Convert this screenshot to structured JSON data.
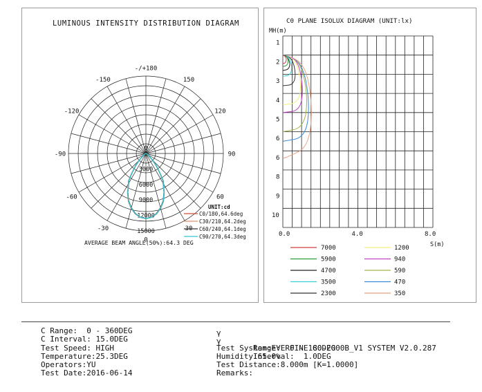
{
  "left_chart": {
    "title": "LUMINOUS INTENSITY DISTRIBUTION DIAGRAM",
    "angle_labels": [
      "-/+180",
      "-150",
      "150",
      "-120",
      "120",
      "-90",
      "90",
      "-60",
      "60",
      "-30",
      "30",
      "0"
    ],
    "radial_labels": [
      "0",
      "3000",
      "6000",
      "9000",
      "12000",
      "15000"
    ],
    "unit_label": "UNIT:cd",
    "legend": [
      {
        "text": "C0/180,64.6deg",
        "color": "#d04a3a"
      },
      {
        "text": "C30/210,64.2deg",
        "color": "#e08f6a"
      },
      {
        "text": "C60/240,64.1deg",
        "color": "#333333"
      },
      {
        "text": "C90/270,64.3deg",
        "color": "#34c6d2"
      }
    ],
    "beam_angle_text": "AVERAGE BEAM ANGLE(50%):64.3 DEG"
  },
  "right_chart": {
    "title": "C0 PLANE ISOLUX DIAGRAM (UNIT:lx)",
    "y_axis_label": "MH(m)",
    "x_axis_label": "S(m)",
    "y_ticks": [
      "1",
      "2",
      "3",
      "4",
      "5",
      "6",
      "6",
      "8",
      "9",
      "10"
    ],
    "x_ticks": [
      "0.0",
      "4.0",
      "8.0"
    ],
    "legend": [
      {
        "value": "7000",
        "color": "#d23c3c"
      },
      {
        "value": "1200",
        "color": "#f2f07a"
      },
      {
        "value": "5900",
        "color": "#2d9a3a"
      },
      {
        "value": "940",
        "color": "#c040c8"
      },
      {
        "value": "4700",
        "color": "#222222"
      },
      {
        "value": "590",
        "color": "#a4b44a"
      },
      {
        "value": "3500",
        "color": "#38d0d8"
      },
      {
        "value": "470",
        "color": "#3a8ad8"
      },
      {
        "value": "2300",
        "color": "#333333"
      },
      {
        "value": "350",
        "color": "#e8a080"
      }
    ]
  },
  "chart_data": [
    {
      "type": "polar-line",
      "title": "LUMINOUS INTENSITY DISTRIBUTION DIAGRAM",
      "unit": "cd",
      "angle_ticks": [
        "-/+180",
        "-150",
        "150",
        "-120",
        "120",
        "-90",
        "90",
        "-60",
        "60",
        "-30",
        "30",
        "0"
      ],
      "radial_ticks": [
        0,
        3000,
        6000,
        9000,
        12000,
        15000
      ],
      "rmax": 15000,
      "series": [
        {
          "name": "C0/180,64.6deg",
          "color": "#d04a3a",
          "angles": [
            0,
            5,
            10,
            15,
            20,
            25,
            30,
            32.3,
            35,
            40,
            45,
            50,
            55,
            60,
            70,
            80,
            90
          ],
          "values": [
            12600,
            12400,
            11900,
            11000,
            9900,
            8400,
            6700,
            6300,
            5000,
            3200,
            1800,
            1000,
            600,
            380,
            150,
            40,
            0
          ]
        },
        {
          "name": "C30/210,64.2deg",
          "color": "#e08f6a",
          "angles": [
            0,
            5,
            10,
            15,
            20,
            25,
            30,
            32.1,
            35,
            40,
            45,
            50,
            55,
            60,
            70,
            80,
            90
          ],
          "values": [
            12600,
            12400,
            11800,
            10900,
            9800,
            8300,
            6700,
            6300,
            4900,
            3100,
            1800,
            1000,
            600,
            370,
            140,
            40,
            0
          ]
        },
        {
          "name": "C60/240,64.1deg",
          "color": "#333333",
          "angles": [
            0,
            5,
            10,
            15,
            20,
            25,
            30,
            32.05,
            35,
            40,
            45,
            50,
            55,
            60,
            70,
            80,
            90
          ],
          "values": [
            12600,
            12400,
            11800,
            10900,
            9800,
            8300,
            6700,
            6300,
            4900,
            3100,
            1800,
            1000,
            600,
            370,
            140,
            40,
            0
          ]
        },
        {
          "name": "C90/270,64.3deg",
          "color": "#34c6d2",
          "angles": [
            0,
            5,
            10,
            15,
            20,
            25,
            30,
            32.15,
            35,
            40,
            45,
            50,
            55,
            60,
            70,
            80,
            90
          ],
          "values": [
            12600,
            12400,
            11850,
            10950,
            9850,
            8350,
            6700,
            6300,
            4950,
            3150,
            1800,
            1000,
            600,
            375,
            145,
            40,
            0
          ]
        }
      ],
      "annotation": "AVERAGE BEAM ANGLE(50%):64.3 DEG"
    },
    {
      "type": "contour",
      "title": "C0 PLANE ISOLUX DIAGRAM (UNIT:lx)",
      "xlabel": "S(m)",
      "ylabel": "MH(m)",
      "xlim": [
        0,
        8
      ],
      "ylim": [
        10,
        0
      ],
      "series": [
        {
          "name": "7000",
          "color": "#d23c3c",
          "x": [
            0,
            0.12,
            0.2,
            0.15,
            0
          ],
          "y": [
            1,
            1.05,
            1.2,
            1.4,
            1.45
          ]
        },
        {
          "name": "5900",
          "color": "#2d9a3a",
          "x": [
            0,
            0.2,
            0.3,
            0.22,
            0
          ],
          "y": [
            1,
            1.05,
            1.3,
            1.55,
            1.6
          ]
        },
        {
          "name": "4700",
          "color": "#222222",
          "x": [
            0,
            0.25,
            0.4,
            0.3,
            0
          ],
          "y": [
            1,
            1.1,
            1.45,
            1.75,
            1.8
          ]
        },
        {
          "name": "3500",
          "color": "#38d0d8",
          "x": [
            0,
            0.35,
            0.5,
            0.4,
            0
          ],
          "y": [
            1,
            1.1,
            1.6,
            2.05,
            2.1
          ]
        },
        {
          "name": "2300",
          "color": "#333333",
          "x": [
            0,
            0.5,
            0.7,
            0.55,
            0
          ],
          "y": [
            1,
            1.15,
            2,
            2.55,
            2.6
          ]
        },
        {
          "name": "1200",
          "color": "#f2f07a",
          "x": [
            0,
            0.7,
            1,
            0.8,
            0
          ],
          "y": [
            1,
            1.2,
            2.6,
            3.5,
            3.6
          ]
        },
        {
          "name": "940",
          "color": "#c040c8",
          "x": [
            0,
            0.8,
            1.1,
            0.9,
            0
          ],
          "y": [
            1,
            1.2,
            2.8,
            3.9,
            4
          ]
        },
        {
          "name": "590",
          "color": "#a4b44a",
          "x": [
            0,
            0.95,
            1.35,
            1.1,
            0
          ],
          "y": [
            1,
            1.3,
            3.3,
            4.8,
            5
          ]
        },
        {
          "name": "470",
          "color": "#3a8ad8",
          "x": [
            0,
            1.05,
            1.45,
            1.2,
            0
          ],
          "y": [
            1,
            1.35,
            3.6,
            5.3,
            5.5
          ]
        },
        {
          "name": "350",
          "color": "#e8a080",
          "x": [
            0,
            1.2,
            1.6,
            1.35,
            0.3,
            0
          ],
          "y": [
            1,
            1.4,
            3.8,
            5.8,
            6.3,
            6.4
          ]
        }
      ]
    }
  ],
  "info": {
    "left": [
      "C Range:  0 - 360DEG",
      "C Interval: 15.0DEG",
      "Test Speed: HIGH",
      "Temperature:25.3DEG",
      "Operators:YU",
      "Test Date:2016-06-14"
    ],
    "right": [
      "  Range:  0 - 180DEG",
      "  Interval:  1.0DEG",
      "Test System:EVERFINE GO-2000B_V1 SYSTEM V2.0.287",
      "Humidity:65.0%",
      "Test Distance:8.000m [K=1.0000]",
      "Remarks:"
    ],
    "gamma_symbol": "γ"
  }
}
